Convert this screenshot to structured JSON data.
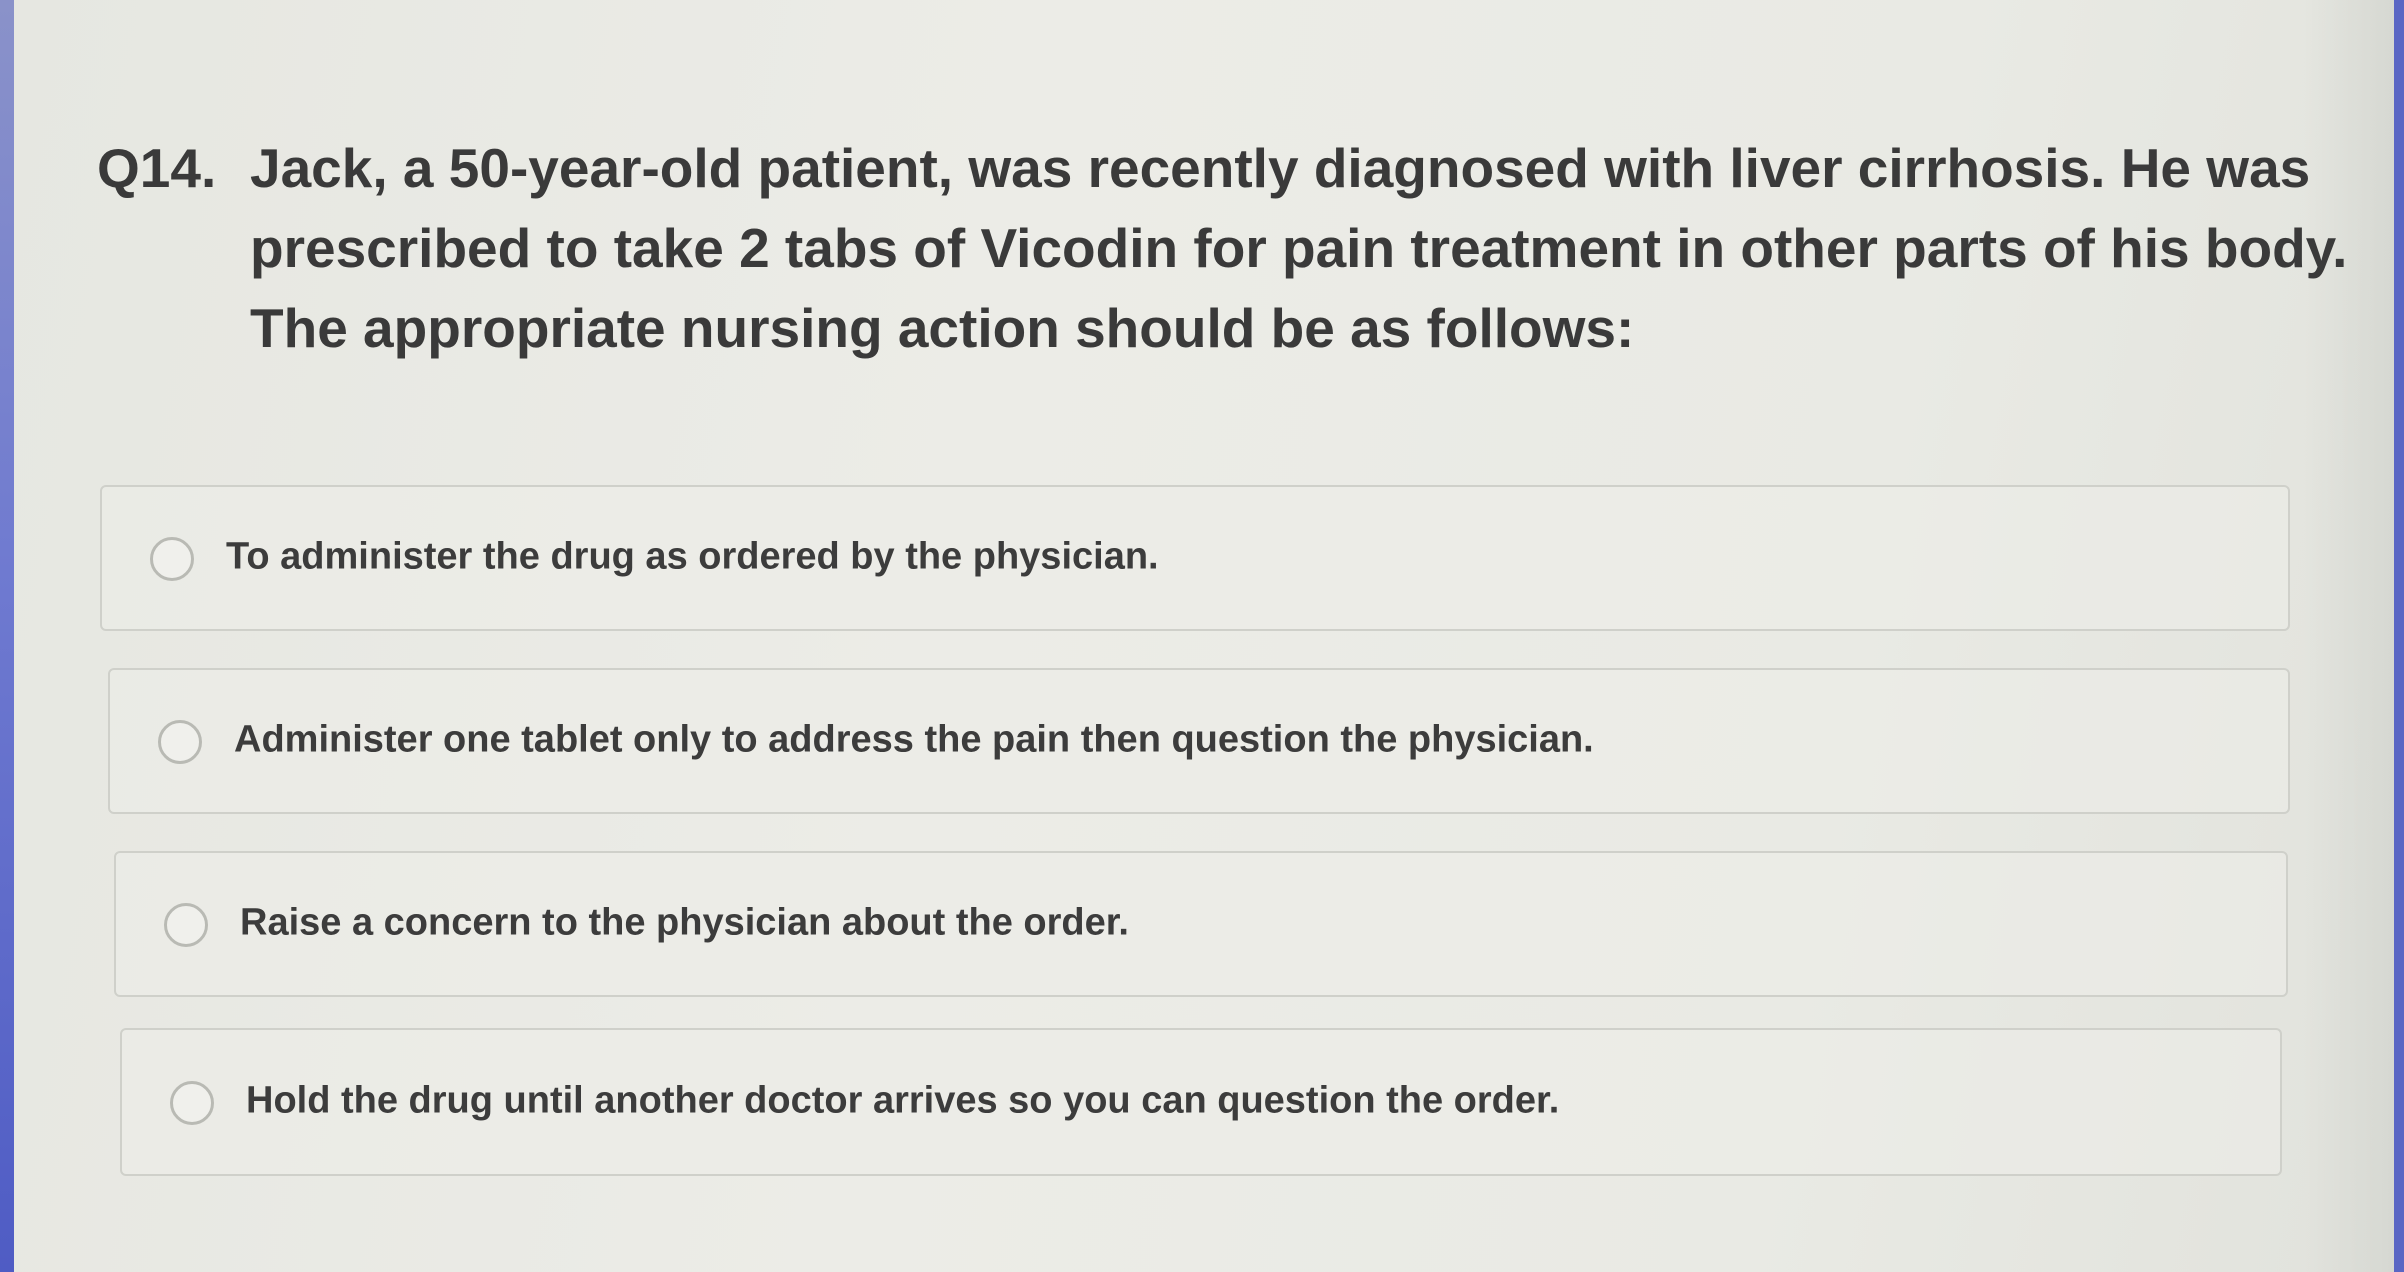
{
  "question": {
    "number": "Q14.",
    "text": "Jack, a 50-year-old patient, was recently diagnosed with liver cirrhosis. He was prescribed to take 2 tabs of Vicodin for pain treatment in other parts of his body. The appropriate nursing action should be as follows:"
  },
  "options": [
    {
      "label": "To administer the drug as ordered by the physician.",
      "selected": false
    },
    {
      "label": "Administer one tablet only to address the pain then question the physician.",
      "selected": false
    },
    {
      "label": "Raise a concern to the physician about the order.",
      "selected": false
    },
    {
      "label": "Hold the drug until another doctor arrives so you can question the order.",
      "selected": false
    }
  ]
}
